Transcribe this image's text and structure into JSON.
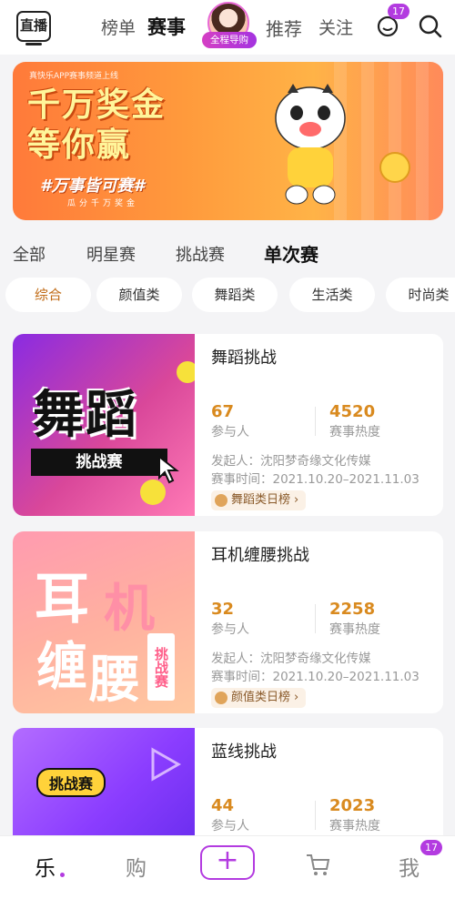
{
  "header": {
    "live_label": "直播",
    "tabs": [
      "榜单",
      "赛事",
      "推荐",
      "关注"
    ],
    "guide_label": "全程导购",
    "message_badge": "17"
  },
  "banner": {
    "top_text": "真快乐APP赛事频道上线",
    "title_line1": "千万奖金",
    "title_line2": "等你赢",
    "slogan": "#万事皆可赛#",
    "sub": "瓜分千万奖金"
  },
  "filter_tabs": [
    "全部",
    "明星赛",
    "挑战赛",
    "单次赛"
  ],
  "category_pills": [
    "综合",
    "颜值类",
    "舞蹈类",
    "生活类",
    "时尚类"
  ],
  "cards": [
    {
      "title": "舞蹈挑战",
      "participants": "67",
      "participants_label": "参与人",
      "heat": "4520",
      "heat_label": "赛事热度",
      "organizer": "发起人：沈阳梦奇缘文化传媒",
      "time": "赛事时间：2021.10.20–2021.11.03",
      "rank": "舞蹈类日榜",
      "thumb_big": "舞蹈",
      "thumb_box": "挑战赛"
    },
    {
      "title": "耳机缠腰挑战",
      "participants": "32",
      "participants_label": "参与人",
      "heat": "2258",
      "heat_label": "赛事热度",
      "organizer": "发起人：沈阳梦奇缘文化传媒",
      "time": "赛事时间：2021.10.20–2021.11.03",
      "rank": "颜值类日榜",
      "thumb_chars": [
        "耳",
        "机",
        "缠",
        "腰"
      ],
      "thumb_tag": "挑战赛"
    },
    {
      "title": "蓝线挑战",
      "participants": "44",
      "participants_label": "参与人",
      "heat": "2023",
      "heat_label": "赛事热度",
      "thumb_label": "挑战赛"
    }
  ],
  "bottom_nav": {
    "items": [
      "乐",
      "购",
      "我"
    ],
    "me_badge": "17"
  },
  "colors": {
    "accent": "#b33be0",
    "stat": "#d98a1f"
  }
}
